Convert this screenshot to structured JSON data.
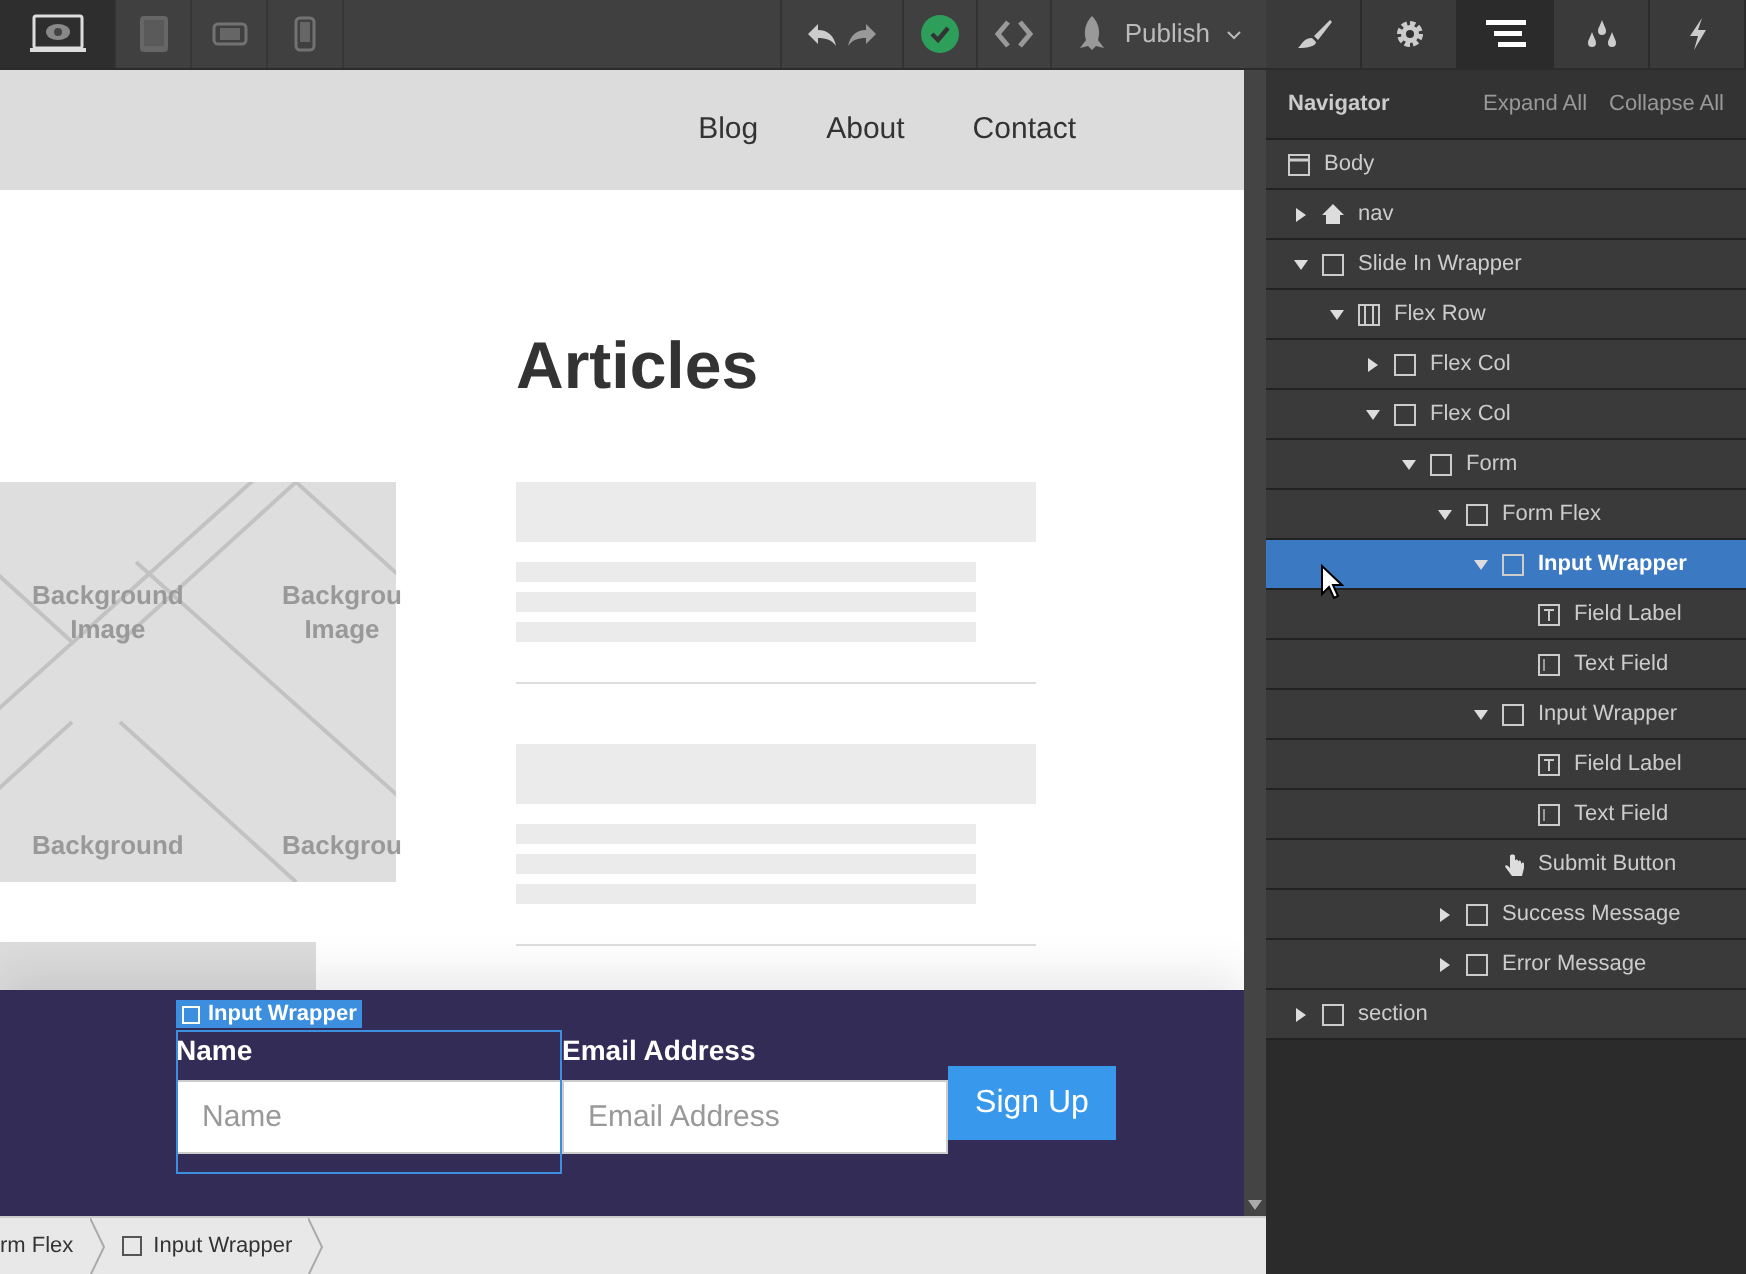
{
  "toolbar": {
    "devices": [
      {
        "kind": "desktop",
        "selected": true
      },
      {
        "kind": "tablet",
        "selected": false
      },
      {
        "kind": "landscape",
        "selected": false
      },
      {
        "kind": "phone",
        "selected": false
      }
    ],
    "publish": "Publish"
  },
  "panel_tabs": [
    {
      "kind": "style",
      "selected": false
    },
    {
      "kind": "settings",
      "selected": false
    },
    {
      "kind": "navigator",
      "selected": true
    },
    {
      "kind": "swatches",
      "selected": false
    },
    {
      "kind": "interactions",
      "selected": false
    }
  ],
  "site": {
    "nav_links": [
      "Blog",
      "About",
      "Contact"
    ],
    "heading": "Articles",
    "placeholder_labels": [
      {
        "lines": [
          "Background",
          "Image"
        ]
      },
      {
        "lines": [
          "Backgrou",
          "Image"
        ]
      },
      {
        "lines": [
          "Background"
        ]
      },
      {
        "lines": [
          "Backgrou"
        ]
      }
    ],
    "selection_tag": "Input Wrapper",
    "form": {
      "fields": [
        {
          "label": "Name",
          "placeholder": "Name",
          "selected": true
        },
        {
          "label": "Email Address",
          "placeholder": "Email Address",
          "selected": false
        }
      ],
      "button": "Sign Up"
    }
  },
  "navigator": {
    "title": "Navigator",
    "expand_all": "Expand All",
    "collapse_all": "Collapse All",
    "tree": [
      {
        "label": "Body",
        "kind": "body",
        "selected": false,
        "children": [
          {
            "label": "nav",
            "kind": "nav",
            "expanded": false,
            "selected": false
          },
          {
            "label": "Slide In Wrapper",
            "kind": "block",
            "expanded": true,
            "selected": false,
            "children": [
              {
                "label": "Flex Row",
                "kind": "row",
                "expanded": true,
                "selected": false,
                "children": [
                  {
                    "label": "Flex Col",
                    "kind": "block",
                    "expanded": false,
                    "selected": false
                  },
                  {
                    "label": "Flex Col",
                    "kind": "block",
                    "expanded": true,
                    "selected": false,
                    "children": [
                      {
                        "label": "Form",
                        "kind": "block",
                        "expanded": true,
                        "selected": false,
                        "children": [
                          {
                            "label": "Form Flex",
                            "kind": "block",
                            "expanded": true,
                            "selected": false,
                            "children": [
                              {
                                "label": "Input Wrapper",
                                "kind": "block",
                                "expanded": true,
                                "selected": true,
                                "children": [
                                  {
                                    "label": "Field Label",
                                    "kind": "label",
                                    "selected": false
                                  },
                                  {
                                    "label": "Text Field",
                                    "kind": "field",
                                    "selected": false
                                  }
                                ]
                              },
                              {
                                "label": "Input Wrapper",
                                "kind": "block",
                                "expanded": true,
                                "selected": false,
                                "children": [
                                  {
                                    "label": "Field Label",
                                    "kind": "label",
                                    "selected": false
                                  },
                                  {
                                    "label": "Text Field",
                                    "kind": "field",
                                    "selected": false
                                  }
                                ]
                              },
                              {
                                "label": "Submit Button",
                                "kind": "button",
                                "selected": false
                              }
                            ]
                          },
                          {
                            "label": "Success Message",
                            "kind": "block",
                            "expanded": false,
                            "selected": false
                          },
                          {
                            "label": "Error Message",
                            "kind": "block",
                            "expanded": false,
                            "selected": false
                          }
                        ]
                      }
                    ]
                  }
                ]
              }
            ]
          },
          {
            "label": "section",
            "kind": "block",
            "expanded": false,
            "selected": false
          }
        ]
      }
    ]
  },
  "breadcrumbs": [
    "rm Flex",
    "Input Wrapper"
  ]
}
